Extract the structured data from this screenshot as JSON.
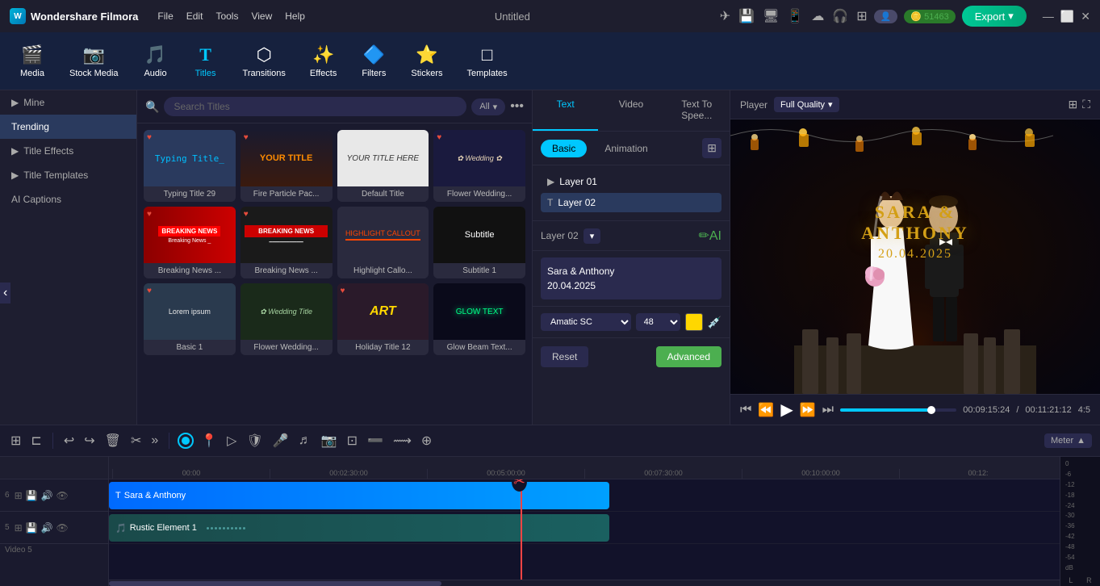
{
  "app": {
    "title": "Wondershare Filmora",
    "project": "Untitled",
    "coins": "51463"
  },
  "menu": {
    "items": [
      "File",
      "Edit",
      "Tools",
      "View",
      "Help"
    ]
  },
  "toolbar": {
    "items": [
      {
        "id": "media",
        "label": "Media",
        "icon": "🎬"
      },
      {
        "id": "stock",
        "label": "Stock Media",
        "icon": "📷"
      },
      {
        "id": "audio",
        "label": "Audio",
        "icon": "🎵"
      },
      {
        "id": "titles",
        "label": "Titles",
        "icon": "T"
      },
      {
        "id": "transitions",
        "label": "Transitions",
        "icon": "⬡"
      },
      {
        "id": "effects",
        "label": "Effects",
        "icon": "✨"
      },
      {
        "id": "filters",
        "label": "Filters",
        "icon": "🔷"
      },
      {
        "id": "stickers",
        "label": "Stickers",
        "icon": "⭐"
      },
      {
        "id": "templates",
        "label": "Templates",
        "icon": "□"
      }
    ],
    "active": "titles"
  },
  "left_panel": {
    "categories": [
      {
        "id": "mine",
        "label": "Mine",
        "has_arrow": true
      },
      {
        "id": "trending",
        "label": "Trending",
        "active": true
      },
      {
        "id": "title_effects",
        "label": "Title Effects",
        "has_arrow": true
      },
      {
        "id": "title_templates",
        "label": "Title Templates",
        "has_arrow": true
      },
      {
        "id": "ai_captions",
        "label": "AI Captions"
      }
    ]
  },
  "titles_panel": {
    "search_placeholder": "Search Titles",
    "filter": "All",
    "cards": [
      {
        "id": "typing",
        "label": "Typing Title 29",
        "style": "typing",
        "text": "Typing Title"
      },
      {
        "id": "fire",
        "label": "Fire Particle Pac...",
        "style": "fire",
        "text": "YOUR TITLE"
      },
      {
        "id": "default",
        "label": "Default Title",
        "style": "default",
        "text": "YOUR TITLE HERE"
      },
      {
        "id": "flower_wedding",
        "label": "Flower Wedding...",
        "style": "flower",
        "text": ""
      },
      {
        "id": "breaking1",
        "label": "Breaking News ...",
        "style": "breaking-red",
        "text": "BREAKING NEWS"
      },
      {
        "id": "breaking2",
        "label": "Breaking News ...",
        "style": "breaking-dark",
        "text": "BREAKING NEWS"
      },
      {
        "id": "highlight",
        "label": "Highlight Callo...",
        "style": "highlight",
        "text": "HIGHLIGHT"
      },
      {
        "id": "subtitle1",
        "label": "Subtitle 1",
        "style": "subtitle",
        "text": "Subtitle"
      },
      {
        "id": "basic1",
        "label": "Basic 1",
        "style": "basic",
        "text": ""
      },
      {
        "id": "flower2",
        "label": "Flower Wedding...",
        "style": "flower2",
        "text": ""
      },
      {
        "id": "holiday",
        "label": "Holiday Title 12",
        "style": "holiday",
        "text": "ART"
      },
      {
        "id": "glow",
        "label": "Glow Beam Text...",
        "style": "glow",
        "text": "GLOW TEXT"
      }
    ]
  },
  "props_panel": {
    "tabs": [
      {
        "id": "text",
        "label": "Text",
        "active": true
      },
      {
        "id": "video",
        "label": "Video"
      },
      {
        "id": "text_to_speech",
        "label": "Text To Spee..."
      }
    ],
    "sub_tabs": [
      {
        "id": "basic",
        "label": "Basic",
        "active": true
      },
      {
        "id": "animation",
        "label": "Animation"
      }
    ],
    "layers": [
      {
        "id": "layer01",
        "label": "Layer 01",
        "icon": "▶"
      },
      {
        "id": "layer02",
        "label": "Layer 02",
        "icon": "T",
        "active": true
      }
    ],
    "active_layer": "Layer 02",
    "text_content": "Sara & Anthony\n20.04.2025",
    "font": "Amatic SC",
    "size": "48",
    "color": "#ffd700",
    "reset_label": "Reset",
    "advanced_label": "Advanced"
  },
  "player": {
    "label": "Player",
    "quality": "Full Quality",
    "title_text": "SARA & ANTHONY",
    "date_text": "20.04.2025",
    "current_time": "00:09:15:24",
    "total_time": "00:11:21:12",
    "ratio": "4:5",
    "progress": 82
  },
  "timeline": {
    "meter_label": "Meter",
    "ruler_marks": [
      "00:00",
      "00:02:30:00",
      "00:05:00:00",
      "00:07:30:00",
      "00:10:00:00",
      "00:12:"
    ],
    "tracks": [
      {
        "id": "video6",
        "number": "6",
        "clip_label": "Sara & Anthony",
        "clip_type": "title",
        "icon": "T"
      },
      {
        "id": "video5",
        "number": "5",
        "clip_label": "Rustic Element 1",
        "clip_type": "audio",
        "icon": "🎵",
        "track_label": "Video 5"
      }
    ],
    "meter_labels": [
      "0",
      "-6",
      "-12",
      "-18",
      "-24",
      "-30",
      "-36",
      "-42",
      "-48",
      "-54",
      "dB"
    ],
    "lr_labels": [
      "L",
      "R"
    ]
  }
}
